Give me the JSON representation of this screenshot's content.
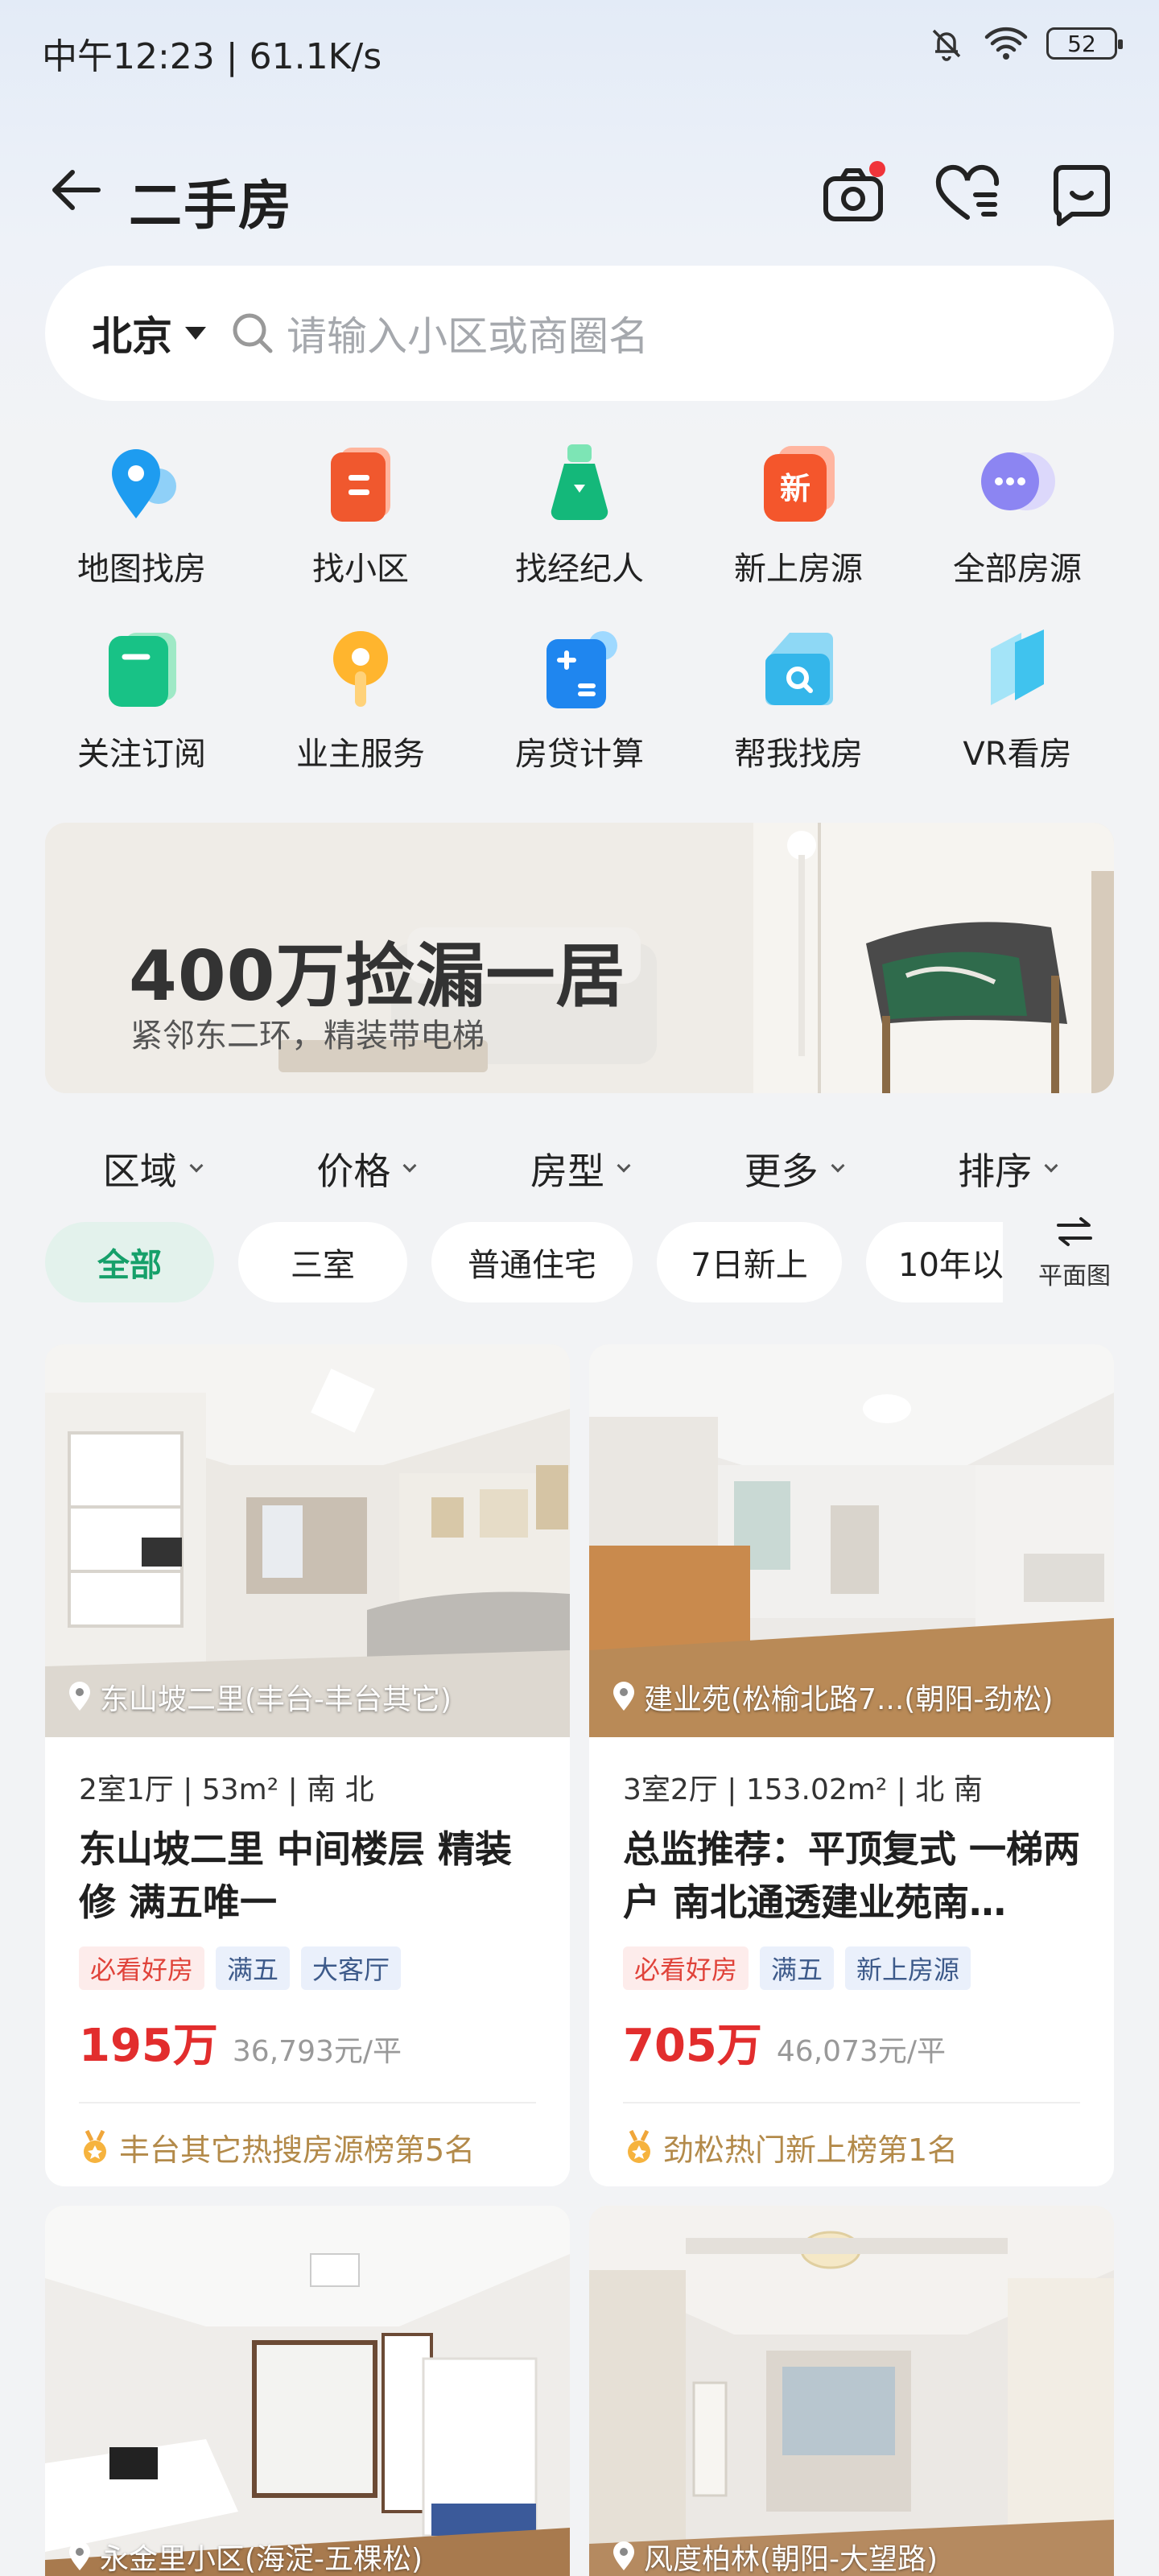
{
  "status_bar": {
    "time": "中午12:23 | 61.1K/s",
    "battery": "52"
  },
  "header": {
    "title": "二手房"
  },
  "search": {
    "city": "北京",
    "placeholder": "请输入小区或商圈名"
  },
  "quick_menu": [
    {
      "label": "地图找房",
      "icon": "map-pin-icon"
    },
    {
      "label": "找小区",
      "icon": "building-icon"
    },
    {
      "label": "找经纪人",
      "icon": "agent-icon"
    },
    {
      "label": "新上房源",
      "icon": "new-listing-icon"
    },
    {
      "label": "全部房源",
      "icon": "more-dots-icon"
    },
    {
      "label": "关注订阅",
      "icon": "subscribe-icon"
    },
    {
      "label": "业主服务",
      "icon": "owner-service-icon"
    },
    {
      "label": "房贷计算",
      "icon": "calculator-icon"
    },
    {
      "label": "帮我找房",
      "icon": "find-house-icon"
    },
    {
      "label": "VR看房",
      "icon": "vr-icon"
    }
  ],
  "banner": {
    "title": "400万捡漏一居",
    "subtitle": "紧邻东二环，精装带电梯"
  },
  "filters": [
    "区域",
    "价格",
    "房型",
    "更多",
    "排序"
  ],
  "chips": [
    "全部",
    "三室",
    "普通住宅",
    "7日新上",
    "10年以"
  ],
  "floorplan_label": "平面图",
  "listings": [
    {
      "location": "东山坡二里(丰台-丰台其它)",
      "spec": "2室1厅 | 53m² | 南 北",
      "title": "东山坡二里 中间楼层 精装修 满五唯一",
      "tags": [
        "必看好房",
        "满五",
        "大客厅"
      ],
      "price": "195万",
      "unit_price": "36,793元/平",
      "rank": "丰台其它热搜房源榜第5名"
    },
    {
      "location": "建业苑(松榆北路7...(朝阳-劲松)",
      "spec": "3室2厅 | 153.02m² | 北 南",
      "title": "总监推荐：平顶复式 一梯两户 南北通透建业苑南…",
      "tags": [
        "必看好房",
        "满五",
        "新上房源"
      ],
      "price": "705万",
      "unit_price": "46,073元/平",
      "rank": "劲松热门新上榜第1名"
    },
    {
      "location": "永金里小区(海淀-五棵松)"
    },
    {
      "location": "风度柏林(朝阳-大望路)"
    }
  ]
}
